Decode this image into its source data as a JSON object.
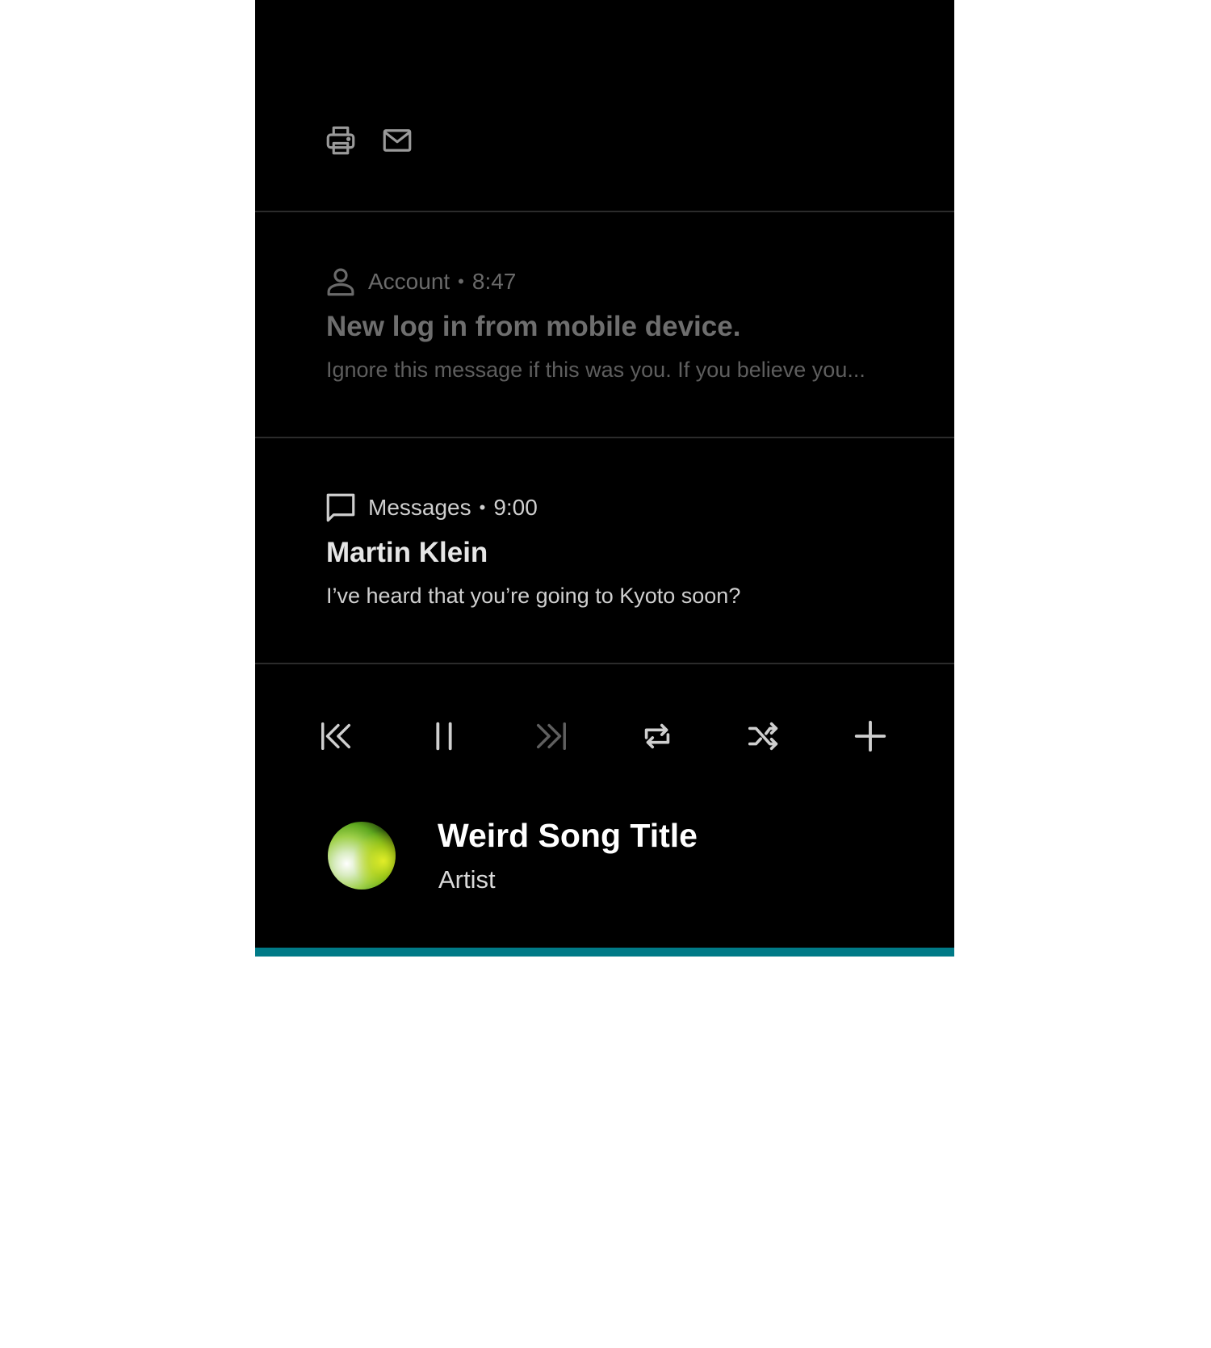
{
  "toolbar": {
    "icons": [
      "printer-icon",
      "mail-icon"
    ]
  },
  "notifications": [
    {
      "icon": "person-icon",
      "app": "Account",
      "separator": "•",
      "time": "8:47",
      "title": "New log in from mobile device.",
      "body": "Ignore this message if this was you. If you believe you...",
      "state": "dimmed"
    },
    {
      "icon": "message-icon",
      "app": "Messages",
      "separator": "•",
      "time": "9:00",
      "title": "Martin Klein",
      "body": "I’ve heard that you’re going to Kyoto soon?",
      "state": "normal"
    }
  ],
  "media": {
    "controls": [
      "previous-icon",
      "pause-icon",
      "next-icon",
      "repeat-icon",
      "shuffle-icon",
      "add-icon"
    ],
    "disabled_controls": [
      "next-icon"
    ],
    "song_title": "Weird Song Title",
    "artist": "Artist",
    "progress": 1.0,
    "accent_color": "#007a87"
  }
}
